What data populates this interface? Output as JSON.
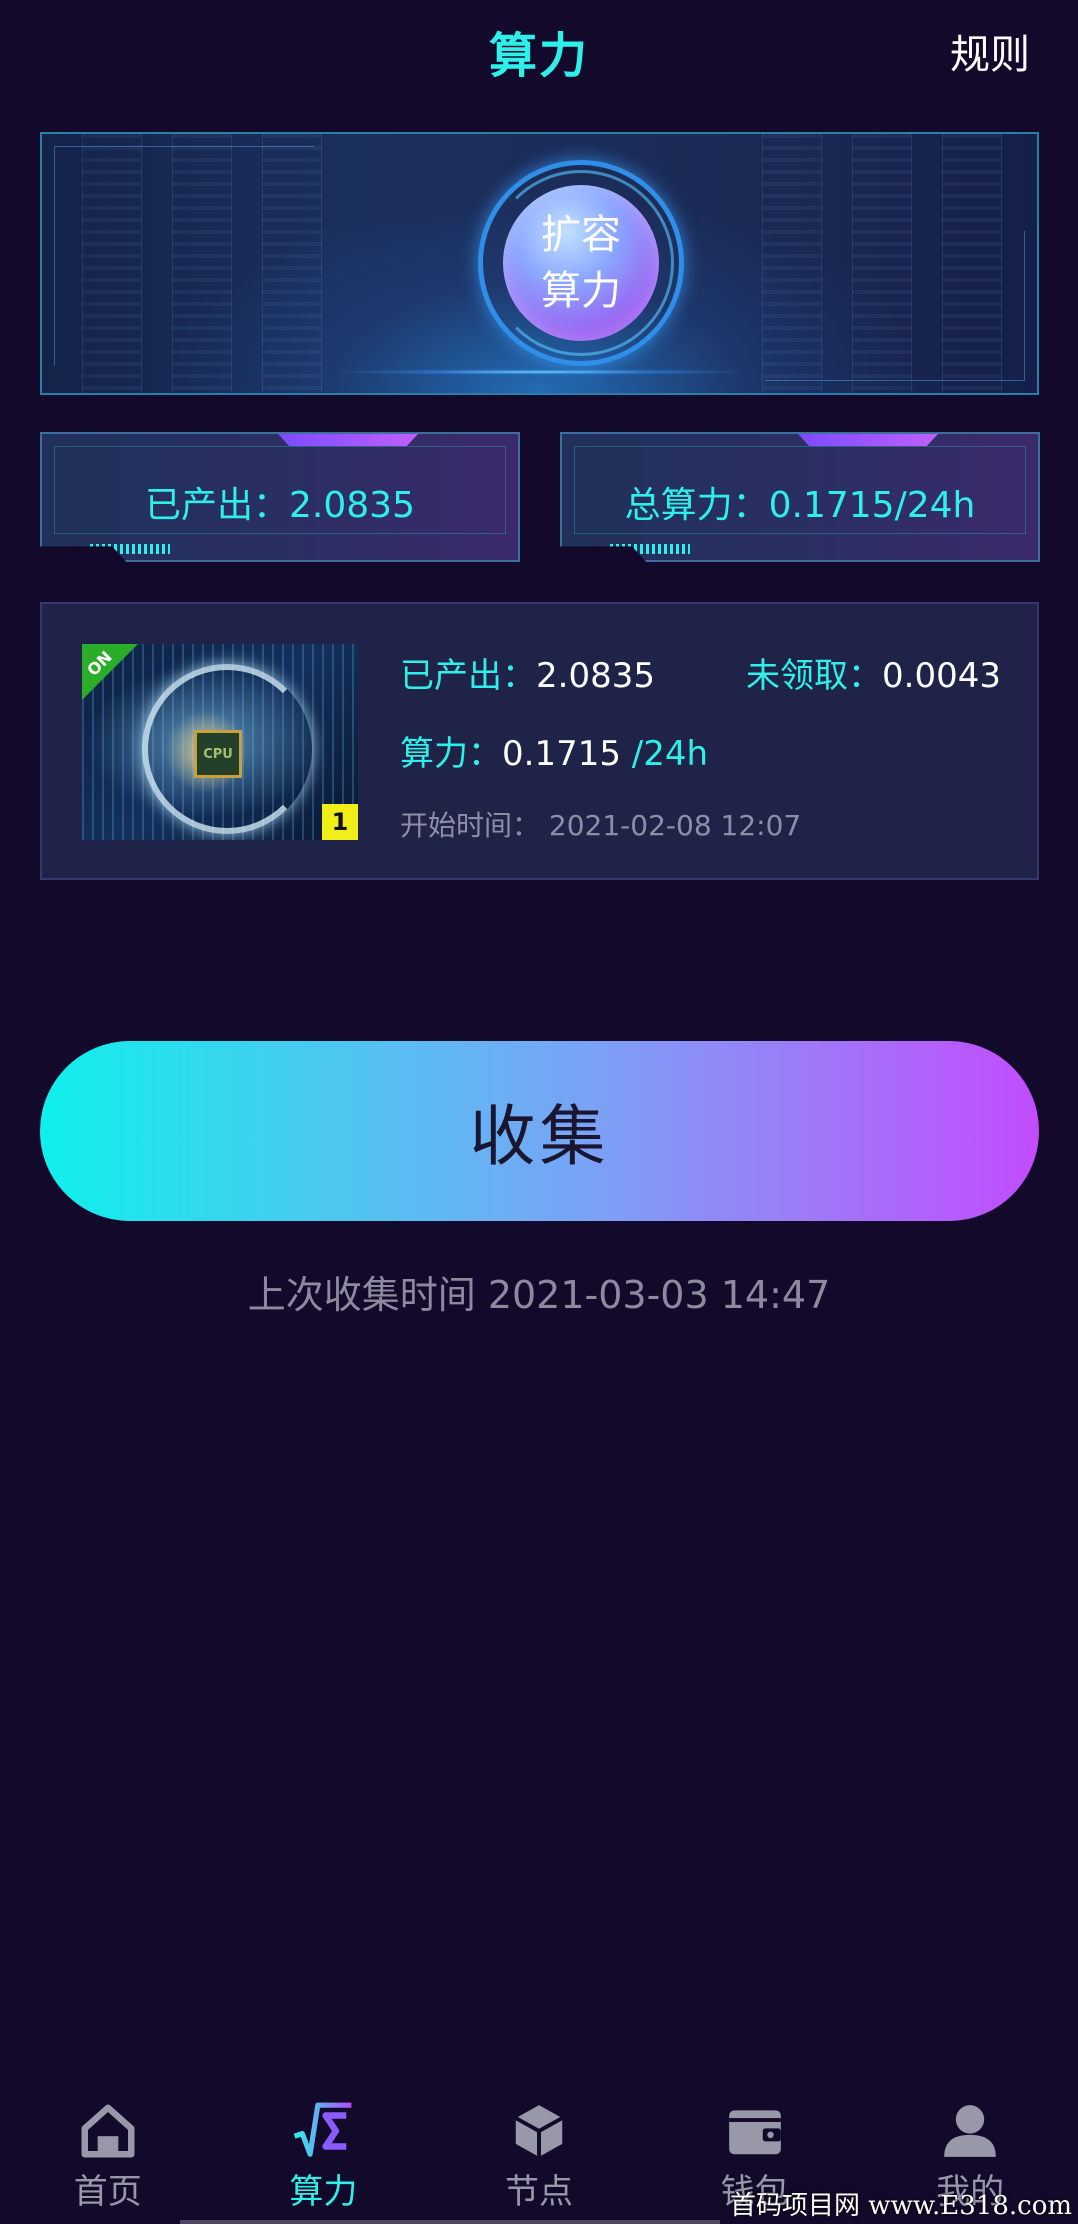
{
  "header": {
    "title": "算力",
    "rules_label": "规则"
  },
  "banner": {
    "orb_line1": "扩容",
    "orb_line2": "算力"
  },
  "stats": {
    "produced": "已产出：2.0835",
    "total_power": "总算力：0.1715/24h"
  },
  "card": {
    "on_badge": "ON",
    "chip_text": "CPU",
    "count_badge": "1",
    "produced_label": "已产出：",
    "produced_value": "2.0835",
    "unclaimed_label": "未领取：",
    "unclaimed_value": "0.0043",
    "power_label": "算力：",
    "power_value": "0.1715",
    "power_unit": " /24h",
    "start_time_label": "开始时间：",
    "start_time_value": " 2021-02-08 12:07"
  },
  "collect": {
    "button_label": "收集",
    "last_collect": "上次收集时间 2021-03-03 14:47"
  },
  "nav": {
    "items": [
      {
        "label": "首页",
        "icon": "home-icon",
        "active": false
      },
      {
        "label": "算力",
        "icon": "sqrt-sigma-icon",
        "active": true
      },
      {
        "label": "节点",
        "icon": "cube-icon",
        "active": false
      },
      {
        "label": "钱包",
        "icon": "wallet-icon",
        "active": false
      },
      {
        "label": "我的",
        "icon": "user-icon",
        "active": false
      }
    ]
  },
  "watermark": "首码项目网 www.E318.com",
  "colors": {
    "background": "#13092b",
    "accent_cyan": "#2ef0ea",
    "accent_purple": "#c14cff",
    "card_bg": "#1f2347"
  }
}
